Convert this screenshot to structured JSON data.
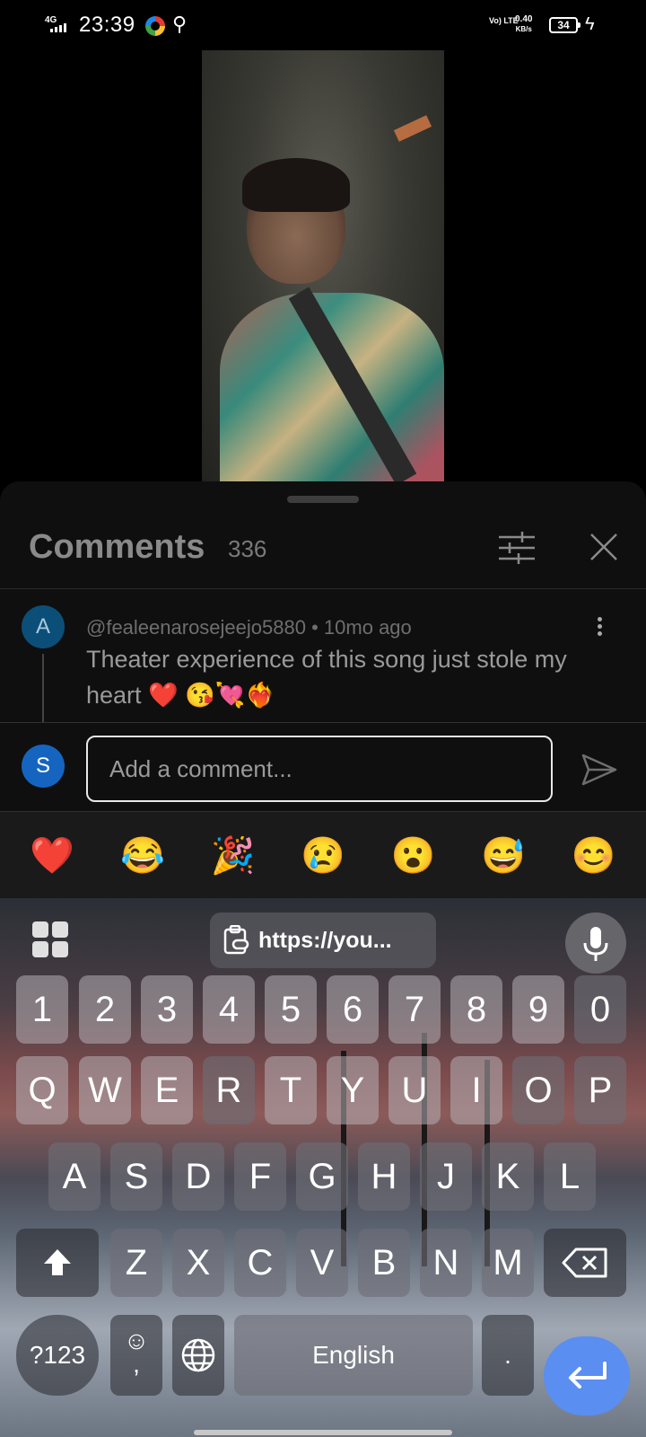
{
  "status_bar": {
    "network": "4G",
    "time": "23:39",
    "volte": "Vo) LTE",
    "speed_value": "0.40",
    "speed_unit": "KB/s",
    "battery": "34"
  },
  "comments": {
    "title": "Comments",
    "count": "336",
    "items": [
      {
        "avatar_letter": "A",
        "author": "@fealeenarosejeejo5880",
        "age": "10mo ago",
        "text": "Theater experience of this song just stole my heart ❤️ 😘💘❤️‍🔥"
      }
    ]
  },
  "input": {
    "avatar_letter": "S",
    "placeholder": "Add a comment..."
  },
  "emoji_row": [
    "❤️",
    "😂",
    "🎉",
    "😢",
    "😮",
    "😅",
    "😊"
  ],
  "keyboard": {
    "clipboard_text": "https://you...",
    "number_row": [
      "1",
      "2",
      "3",
      "4",
      "5",
      "6",
      "7",
      "8",
      "9",
      "0"
    ],
    "row_1": [
      "Q",
      "W",
      "E",
      "R",
      "T",
      "Y",
      "U",
      "I",
      "O",
      "P"
    ],
    "row_2": [
      "A",
      "S",
      "D",
      "F",
      "G",
      "H",
      "J",
      "K",
      "L"
    ],
    "row_3": [
      "Z",
      "X",
      "C",
      "V",
      "B",
      "N",
      "M"
    ],
    "symbols_label": "?123",
    "space_label": "English",
    "period_label": "."
  }
}
